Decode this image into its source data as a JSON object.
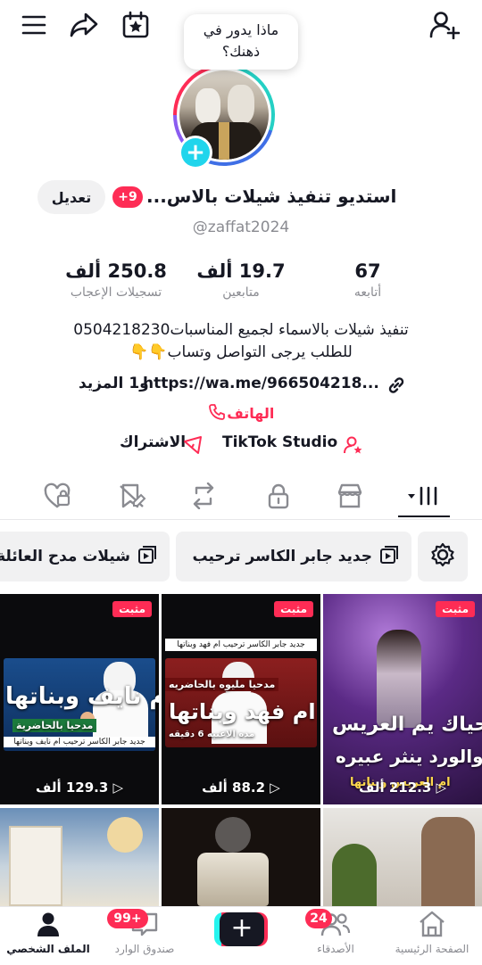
{
  "header": {
    "menu_icon": "menu-icon",
    "share_icon": "share-icon",
    "calendar_icon": "calendar-star-icon",
    "add_friend_icon": "add-user-icon"
  },
  "profile": {
    "bubble_text_line1": "ماذا يدور في",
    "bubble_text_line2": "ذهنك؟",
    "display_name": "استديو تنفيذ شيلات بالاس...",
    "notification_badge": "+9",
    "edit_label": "تعديل",
    "handle": "@zaffat2024"
  },
  "stats": {
    "likes_value": "250.8 ألف",
    "likes_label": "تسجيلات الإعجاب",
    "followers_value": "19.7 ألف",
    "followers_label": "متابعين",
    "following_value": "67",
    "following_label": "أتابعه"
  },
  "bio": {
    "line1": "تنفيذ شيلات بالاسماء لجميع المناسبات0504218230",
    "line2": "للطلب يرجى التواصل وتساب👇👇",
    "link_text": "https://wa.me/966504218...",
    "link_more": "و1 المزيد",
    "phone_label": "الهاتف",
    "studio_label": "TikTok Studio",
    "subscribe_label": "الاشتراك"
  },
  "chips": {
    "chip1": "جديد جابر الكاسر ترحيب",
    "chip2": "شيلات مدح العائلة"
  },
  "videos": [
    {
      "pinned": "مثبت",
      "views": "129.3 ألف",
      "caption": "ام نايف وبناتها",
      "sub": "مدحيا بالحاضرية",
      "footer": "جديد جابر الكاسر ترحيب ام نايف وبناتها"
    },
    {
      "pinned": "مثبت",
      "views": "88.2 ألف",
      "caption": "ام فهد وبناتها",
      "sub": "مدحيا مليوه بالحاضريه",
      "footer": "جديد جابر الكاسر ترحيب ام فهد وبناتها",
      "duration": "مده الاغنيه 6 دقيقه"
    },
    {
      "pinned": "مثبت",
      "views": "212.3 ألف",
      "caption": "حياك يم العريس",
      "sub": "والورد ينثر عبيره",
      "footer": "ام العريس وبناتها"
    }
  ],
  "bottom_nav": {
    "home": "الصفحة الرئيسية",
    "friends": "الأصدقاء",
    "friends_badge": "24",
    "inbox": "صندوق الوارد",
    "inbox_badge": "99+",
    "profile": "الملف الشخصي"
  }
}
